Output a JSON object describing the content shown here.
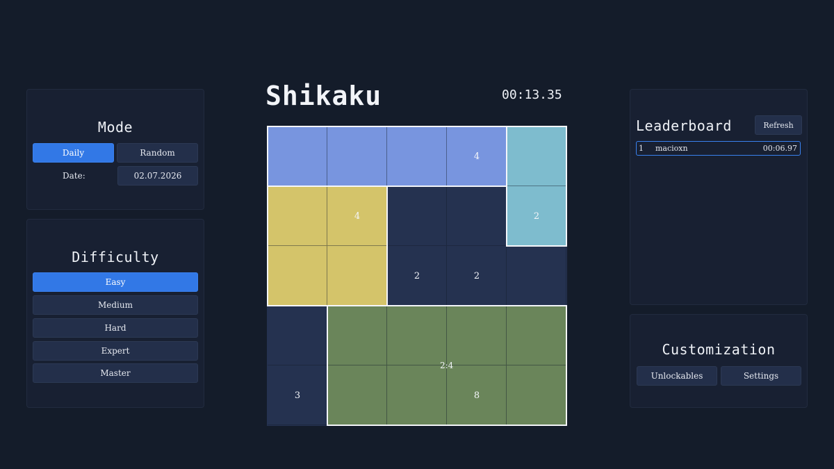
{
  "mode": {
    "title": "Mode",
    "daily_label": "Daily",
    "random_label": "Random",
    "date_label": "Date:",
    "date_value": "02.07.2026",
    "active": "Daily"
  },
  "difficulty": {
    "title": "Difficulty",
    "options": [
      "Easy",
      "Medium",
      "Hard",
      "Expert",
      "Master"
    ],
    "active": "Easy"
  },
  "game": {
    "title": "Shikaku",
    "timer": "00:13.35",
    "grid_size": 5,
    "colors": {
      "empty": "#253250",
      "blue": "#7895df",
      "teal": "#7ebcce",
      "yellow": "#d4c46a",
      "green": "#6a855a"
    },
    "cells": [
      [
        "blue",
        "blue",
        "blue",
        "blue",
        "teal"
      ],
      [
        "yellow",
        "yellow",
        "empty",
        "empty",
        "teal"
      ],
      [
        "yellow",
        "yellow",
        "empty",
        "empty",
        "empty"
      ],
      [
        "empty",
        "green",
        "green",
        "green",
        "green"
      ],
      [
        "empty",
        "green",
        "green",
        "green",
        "green"
      ]
    ],
    "regions": [
      {
        "row": 0,
        "col": 0,
        "rows": 1,
        "cols": 4,
        "color": "blue"
      },
      {
        "row": 0,
        "col": 4,
        "rows": 2,
        "cols": 1,
        "color": "teal"
      },
      {
        "row": 1,
        "col": 0,
        "rows": 2,
        "cols": 2,
        "color": "yellow"
      },
      {
        "row": 3,
        "col": 1,
        "rows": 2,
        "cols": 4,
        "color": "green"
      }
    ],
    "clues": [
      {
        "row": 0,
        "col": 3,
        "value": "4"
      },
      {
        "row": 1,
        "col": 1,
        "value": "4"
      },
      {
        "row": 1,
        "col": 4,
        "value": "2"
      },
      {
        "row": 2,
        "col": 2,
        "value": "2"
      },
      {
        "row": 2,
        "col": 3,
        "value": "2"
      },
      {
        "row": 4,
        "col": 0,
        "value": "3"
      },
      {
        "row": 4,
        "col": 3,
        "value": "8"
      }
    ],
    "dimension_label": "2:4"
  },
  "leaderboard": {
    "title": "Leaderboard",
    "refresh_label": "Refresh",
    "entries": [
      {
        "rank": "1",
        "name": "macioxn",
        "time": "00:06.97"
      }
    ]
  },
  "customization": {
    "title": "Customization",
    "unlockables_label": "Unlockables",
    "settings_label": "Settings"
  }
}
